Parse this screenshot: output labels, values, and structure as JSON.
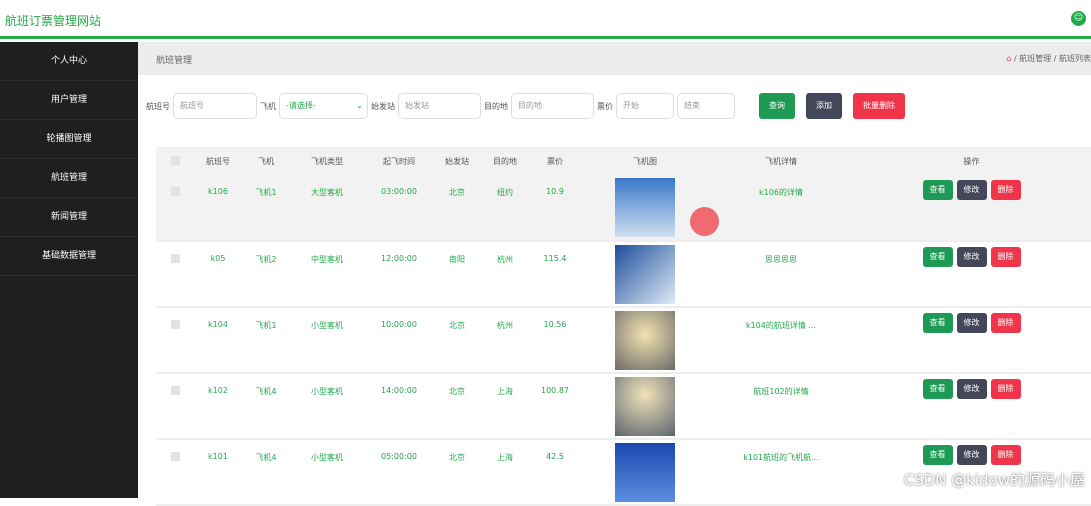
{
  "header": {
    "title": "航班订票管理网站",
    "avatar_icon": "user-icon"
  },
  "sidebar": {
    "items": [
      {
        "label": "个人中心"
      },
      {
        "label": "用户管理"
      },
      {
        "label": "轮播图管理"
      },
      {
        "label": "航班管理"
      },
      {
        "label": "新闻管理"
      },
      {
        "label": "基础数据管理"
      }
    ]
  },
  "page": {
    "heading": "航班管理",
    "breadcrumb": [
      "航班管理",
      "航班列表"
    ]
  },
  "search": {
    "flight_no_label": "航班号",
    "flight_no_placeholder": "航班号",
    "plane_label": "飞机",
    "plane_select": "-请选择-",
    "origin_label": "始发站",
    "origin_placeholder": "始发站",
    "dest_label": "目的地",
    "dest_placeholder": "目的地",
    "price_label": "票价",
    "price_start": "开始",
    "price_end": "结束",
    "query": "查询",
    "add": "添加",
    "batch_delete": "批量删除"
  },
  "table": {
    "headers": [
      "航班号",
      "飞机",
      "飞机类型",
      "起飞时间",
      "始发站",
      "目的地",
      "票价",
      "飞机图",
      "飞机详情",
      "操作"
    ],
    "actions": {
      "view": "查看",
      "edit": "修改",
      "delete": "删除"
    },
    "rows": [
      {
        "no": "k106",
        "plane": "飞机1",
        "type": "大型客机",
        "time": "03:00:00",
        "from": "北京",
        "to": "纽约",
        "price": "10.9",
        "detail": "k106的详情"
      },
      {
        "no": "k05",
        "plane": "飞机2",
        "type": "中型客机",
        "time": "12:00:00",
        "from": "南阳",
        "to": "杭州",
        "price": "115.4",
        "detail": "思思思思"
      },
      {
        "no": "k104",
        "plane": "飞机1",
        "type": "小型客机",
        "time": "10:00:00",
        "from": "北京",
        "to": "杭州",
        "price": "10.56",
        "detail": "k104的航班详情 ..."
      },
      {
        "no": "k102",
        "plane": "飞机4",
        "type": "小型客机",
        "time": "14:00:00",
        "from": "北京",
        "to": "上海",
        "price": "100.87",
        "detail": "航班102的详情"
      },
      {
        "no": "k101",
        "plane": "飞机4",
        "type": "小型客机",
        "time": "05:00:00",
        "from": "北京",
        "to": "上海",
        "price": "42.5",
        "detail": "k101航班的飞机航..."
      }
    ]
  },
  "watermark": "CSDN @kidow的源码小屋"
}
